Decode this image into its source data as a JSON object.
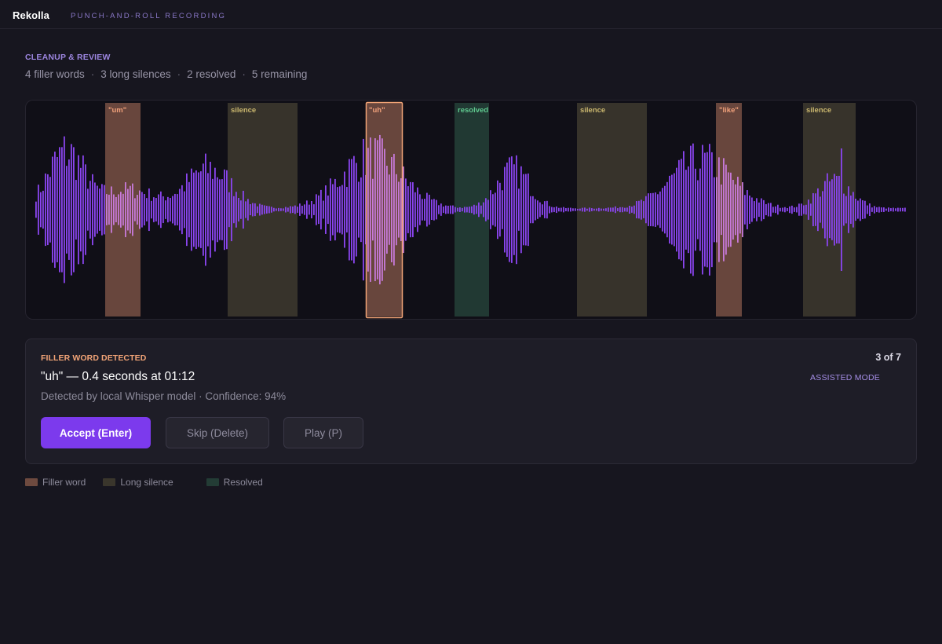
{
  "app": {
    "name": "Rekolla",
    "subtitle": "PUNCH-AND-ROLL RECORDING"
  },
  "review": {
    "section_label": "CLEANUP & REVIEW",
    "stats": [
      "4 filler words",
      "3 long silences",
      "2 resolved",
      "5 remaining"
    ]
  },
  "waveform": {
    "regions": [
      {
        "label": "\"um\"",
        "kind": "filler"
      },
      {
        "label": "silence",
        "kind": "silence"
      },
      {
        "label": "\"uh\"",
        "kind": "filler",
        "selected": true
      },
      {
        "label": "resolved",
        "kind": "resolved"
      },
      {
        "label": "silence",
        "kind": "silence"
      },
      {
        "label": "\"like\"",
        "kind": "filler"
      },
      {
        "label": "silence",
        "kind": "silence"
      }
    ]
  },
  "detection": {
    "label": "FILLER WORD DETECTED",
    "title": "\"uh\" — 0.4 seconds at 01:12",
    "meta": "Detected by local Whisper model · Confidence: 94%",
    "counter": "3 of 7",
    "mode": "ASSISTED MODE",
    "accept_label": "Accept (Enter)",
    "skip_label": "Skip (Delete)",
    "play_label": "Play (P)"
  },
  "legend": {
    "filler": "Filler word",
    "silence": "Long silence",
    "resolved": "Resolved"
  },
  "colors": {
    "accent": "#7c3aed",
    "filler": "#6e4a3f",
    "silence": "#3a362c",
    "resolved": "#233c35",
    "wave": "#8b45f0"
  }
}
